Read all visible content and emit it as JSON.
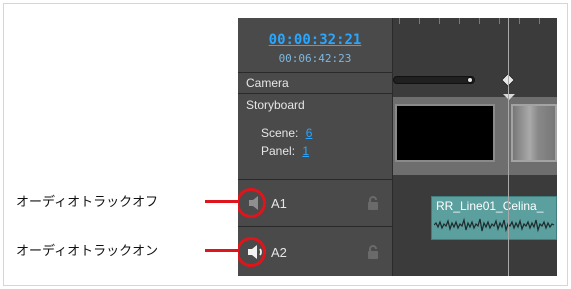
{
  "header": {
    "timecode_main": "00:00:32:21",
    "timecode_sub": "00:06:42:23"
  },
  "layers": {
    "camera": "Camera",
    "storyboard": "Storyboard"
  },
  "scene_panel": {
    "scene_label": "Scene:",
    "scene_value": "6",
    "panel_label": "Panel:",
    "panel_value": "1"
  },
  "tracks": [
    {
      "name": "A1",
      "state": "muted",
      "icon": "speaker-muted-icon",
      "callout": "オーディオトラックオフ"
    },
    {
      "name": "A2",
      "state": "on",
      "icon": "speaker-on-icon",
      "callout": "オーディオトラックオン"
    }
  ],
  "audio_clip": {
    "name": "RR_Line01_Celina_"
  },
  "colors": {
    "panel_bg": "#3b3b3b",
    "left_bg": "#4a4a4a",
    "link": "#2aa6ff",
    "callout_red": "#e0141b",
    "audio_clip": "#5b9f9f"
  }
}
